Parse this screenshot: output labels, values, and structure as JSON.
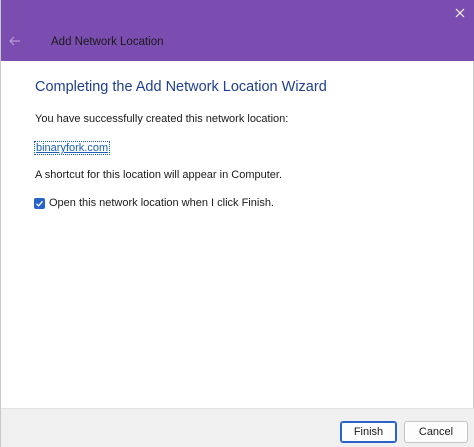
{
  "window": {
    "title": "Add Network Location"
  },
  "icons": {
    "back": "arrow-left-icon",
    "close": "close-icon",
    "check": "check-icon"
  },
  "colors": {
    "titlebar": "#7b4db0",
    "heading": "#1e3f8f",
    "link": "#1f5fb5",
    "accent": "#2a62c9"
  },
  "content": {
    "heading": "Completing the Add Network Location Wizard",
    "success_text": "You have successfully created this network location:",
    "location_link": "binaryfork.com",
    "shortcut_text": "A shortcut for this location will appear in Computer.",
    "open_checkbox": {
      "label": "Open this network location when I click Finish.",
      "checked": true
    }
  },
  "footer": {
    "finish_label": "Finish",
    "cancel_label": "Cancel"
  }
}
